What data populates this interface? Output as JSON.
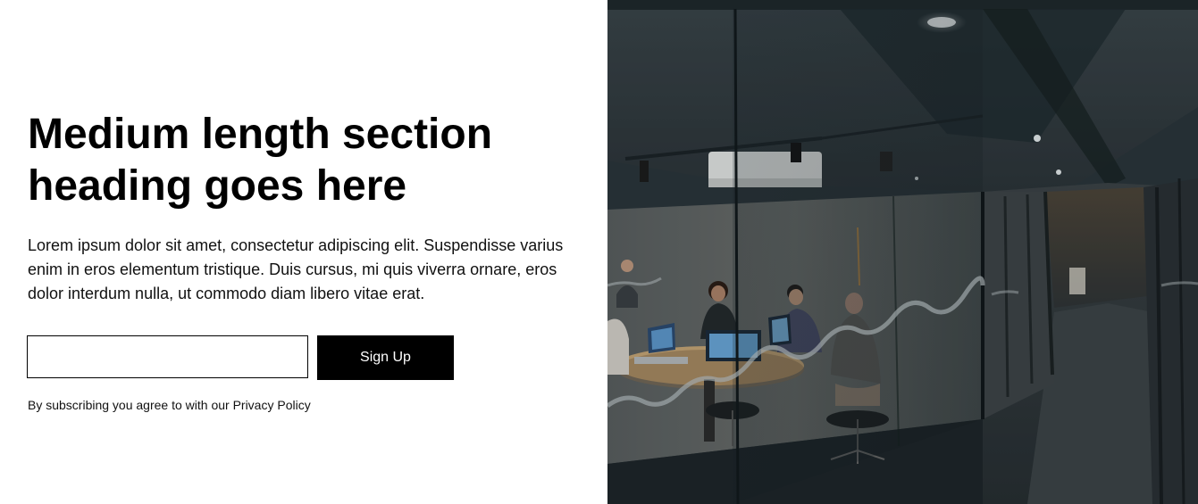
{
  "hero": {
    "heading": "Medium length section heading goes here",
    "body": "Lorem ipsum dolor sit amet, consectetur adipiscing elit. Suspendisse varius enim in eros elementum tristique. Duis cursus, mi quis viverra ornare, eros dolor interdum nulla, ut commodo diam libero vitae erat.",
    "email_input": {
      "value": "",
      "placeholder": ""
    },
    "signup_label": "Sign Up",
    "disclaimer": "By subscribing you agree to with our Privacy Policy"
  },
  "image": {
    "alt": "Office meeting room photo"
  },
  "colors": {
    "button_bg": "#000000",
    "button_text": "#ffffff",
    "photo_tone": "#26323a"
  }
}
